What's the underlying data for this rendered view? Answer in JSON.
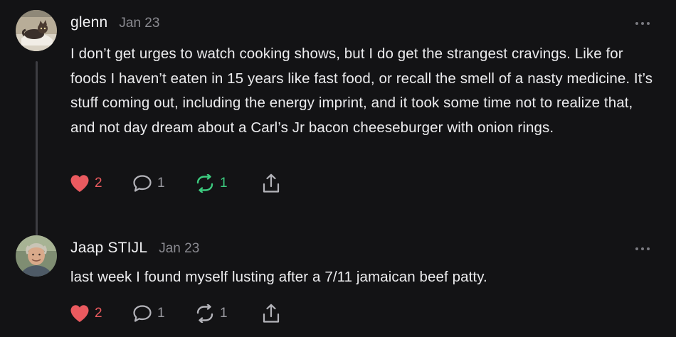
{
  "comments": [
    {
      "author": "glenn",
      "date": "Jan 23",
      "avatar_icon": "cat-photo-avatar",
      "body": "I don’t get urges to watch cooking shows, but I do get the strangest cravings. Like for foods I haven’t eaten in 15 years like fast food, or recall the smell of a nasty medicine. It’s stuff coming out, including the energy imprint, and it took some time not to realize that, and not day dream about a Carl’s Jr bacon cheeseburger with onion rings.",
      "likes": "2",
      "replies": "1",
      "restacks": "1",
      "restacked": true
    },
    {
      "author": "Jaap STIJL",
      "date": "Jan 23",
      "avatar_icon": "person-photo-avatar",
      "body": "last week I found myself lusting after a 7/11 jamaican beef patty.",
      "likes": "2",
      "replies": "1",
      "restacks": "1",
      "restacked": false
    }
  ],
  "colors": {
    "background": "#131315",
    "like": "#ea5a5f",
    "restack_active": "#3ccb7f",
    "muted": "#8a8a90"
  },
  "icons": [
    "heart-icon",
    "comment-bubble-icon",
    "restack-icon",
    "share-icon",
    "more-options-icon"
  ]
}
